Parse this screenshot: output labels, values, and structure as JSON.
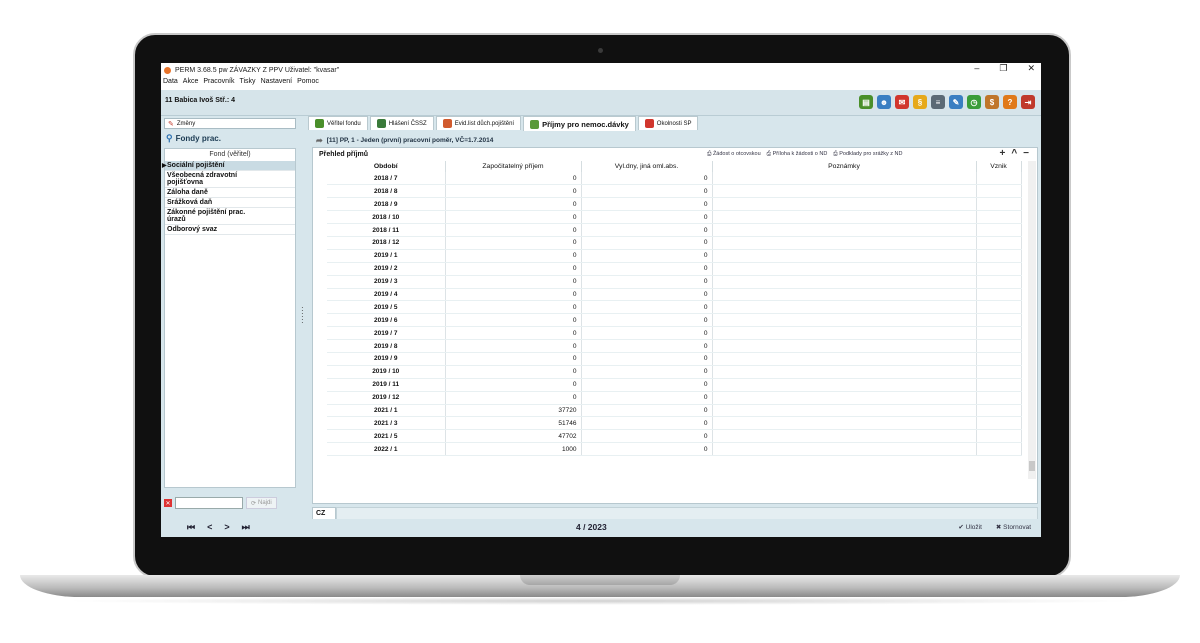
{
  "window": {
    "title": "PERM 3.68.5   pw    ZÁVAZKY Z PPV     Uživatel: \"kvasar\"",
    "minimize": "–",
    "maximize": "❐",
    "close": "✕"
  },
  "menu": [
    "Data",
    "Akce",
    "Pracovník",
    "Tisky",
    "Nastavení",
    "Pomoc"
  ],
  "employee": {
    "label": "11  Babica Ivoš Stř.: 4"
  },
  "toolbar_icons": [
    {
      "name": "id-card-icon",
      "glyph": "▤",
      "color": "#4a8f2a"
    },
    {
      "name": "person-icon",
      "glyph": "☻",
      "color": "#3a7fc2"
    },
    {
      "name": "badge-icon",
      "glyph": "✉",
      "color": "#d1362d"
    },
    {
      "name": "paragraph-icon",
      "glyph": "§",
      "color": "#e6a91a"
    },
    {
      "name": "document-icon",
      "glyph": "≡",
      "color": "#5b6a75"
    },
    {
      "name": "edit-icon",
      "glyph": "✎",
      "color": "#3a7fc2"
    },
    {
      "name": "clock-icon",
      "glyph": "◷",
      "color": "#3a9d3a"
    },
    {
      "name": "money-bag-icon",
      "glyph": "$",
      "color": "#c0762b"
    },
    {
      "name": "help-icon",
      "glyph": "?",
      "color": "#e07a1a"
    },
    {
      "name": "exit-icon",
      "glyph": "⇥",
      "color": "#c0392b"
    }
  ],
  "left": {
    "zmeny_label": "Změny",
    "fondy_label": "Fondy prac.",
    "list_header": "Fond (věřitel)",
    "items": [
      "Sociální pojištění",
      "Všeobecná zdravotní pojišťovna",
      "Záloha daně",
      "Srážková daň",
      "Zákonné pojištění prac. úrazů",
      "Odborový svaz"
    ],
    "find_label": "Najdi"
  },
  "tabs": [
    {
      "label": "Věřitel fondu",
      "color": "#4a8f2a"
    },
    {
      "label": "Hlášení ČSSZ",
      "color": "#3a7a3a"
    },
    {
      "label": "Evid.list důch.pojištění",
      "color": "#d15a2d"
    },
    {
      "label": "Příjmy pro nemoc.dávky",
      "color": "#5a9a3a"
    },
    {
      "label": "Okolnosti SP",
      "color": "#d1362d"
    }
  ],
  "breadcrumb": "[11] PP, 1 - Jeden (první) pracovní poměr, VČ=1.7.2014",
  "panel": {
    "title": "Přehled příjmů",
    "links": [
      "Žádost o otcovskou",
      "Příloha k žádosti o ND",
      "Podklady pro srážky z ND"
    ],
    "controls": [
      "+",
      "^",
      "−"
    ]
  },
  "columns": [
    "Období",
    "Započitatelný příjem",
    "Vyl.dny, jiná oml.abs.",
    "Poznámky",
    "Vznik"
  ],
  "rows": [
    [
      "2018 / 7",
      "0",
      "0"
    ],
    [
      "2018 / 8",
      "0",
      "0"
    ],
    [
      "2018 / 9",
      "0",
      "0"
    ],
    [
      "2018 / 10",
      "0",
      "0"
    ],
    [
      "2018 / 11",
      "0",
      "0"
    ],
    [
      "2018 / 12",
      "0",
      "0"
    ],
    [
      "2019 / 1",
      "0",
      "0"
    ],
    [
      "2019 / 2",
      "0",
      "0"
    ],
    [
      "2019 / 3",
      "0",
      "0"
    ],
    [
      "2019 / 4",
      "0",
      "0"
    ],
    [
      "2019 / 5",
      "0",
      "0"
    ],
    [
      "2019 / 6",
      "0",
      "0"
    ],
    [
      "2019 / 7",
      "0",
      "0"
    ],
    [
      "2019 / 8",
      "0",
      "0"
    ],
    [
      "2019 / 9",
      "0",
      "0"
    ],
    [
      "2019 / 10",
      "0",
      "0"
    ],
    [
      "2019 / 11",
      "0",
      "0"
    ],
    [
      "2019 / 12",
      "0",
      "0"
    ],
    [
      "2021 / 1",
      "37720",
      "0"
    ],
    [
      "2021 / 3",
      "51746",
      "0"
    ],
    [
      "2021 / 5",
      "47702",
      "0"
    ],
    [
      "2022 / 1",
      "1000",
      "0"
    ]
  ],
  "bottom_tab": "CZ",
  "footer": {
    "nav": [
      "⏮",
      "<",
      ">",
      "⏭"
    ],
    "period": "4 / 2023",
    "save": "✔ Uložit",
    "cancel": "✖ Stornovat"
  }
}
